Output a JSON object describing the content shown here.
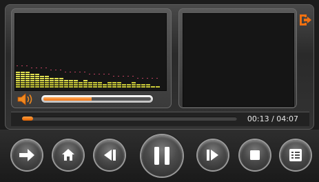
{
  "player": {
    "time_display": "00:13 / 04:07",
    "volume_level": 0.45,
    "progress_level": 0.05,
    "accent_color": "#f07010"
  },
  "icons": {
    "exit": "exit-icon",
    "speaker": "speaker-icon",
    "next": "arrow-right-icon",
    "home": "home-icon",
    "previous": "previous-track-icon",
    "pause": "pause-icon",
    "forward": "next-track-icon",
    "stop": "stop-icon",
    "playlist": "playlist-icon"
  },
  "visualizer": {
    "bars": [
      8,
      8,
      8,
      7,
      7,
      6,
      6,
      5,
      5,
      5,
      4,
      4,
      4,
      3,
      4,
      3,
      3,
      3,
      2,
      3,
      3,
      3,
      2,
      2,
      3,
      2,
      2,
      2,
      1,
      1
    ],
    "peaks": [
      11,
      11,
      11,
      10,
      10,
      10,
      10,
      9,
      9,
      9,
      8,
      8,
      8,
      8,
      8,
      7,
      7,
      7,
      7,
      7,
      6,
      6,
      6,
      6,
      6,
      5,
      5,
      5,
      5,
      5
    ]
  }
}
